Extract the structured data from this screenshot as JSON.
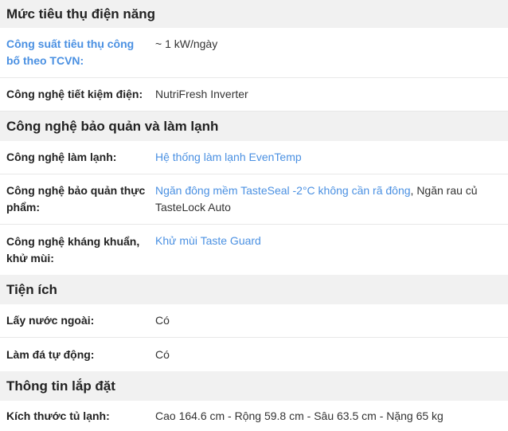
{
  "sections": [
    {
      "title": "Mức tiêu thụ điện năng",
      "rows": [
        {
          "label": "Công suất tiêu thụ công bố theo TCVN:",
          "value": "~ 1 kW/ngày"
        },
        {
          "label": "Công nghệ tiết kiệm điện:",
          "value": "NutriFresh Inverter"
        }
      ]
    },
    {
      "title": "Công nghệ bảo quản và làm lạnh",
      "rows": [
        {
          "label": "Công nghệ làm lạnh:",
          "value": "Hệ thống làm lạnh EvenTemp"
        },
        {
          "label": "Công nghệ bảo quản thực phẩm:",
          "value_link": "Ngăn đông mềm TasteSeal -2°C không cần rã đông",
          "value_rest": ", Ngăn rau củ TasteLock Auto"
        },
        {
          "label": "Công nghệ kháng khuẩn, khử mùi:",
          "value": "Khử mùi Taste Guard"
        }
      ]
    },
    {
      "title": "Tiện ích",
      "rows": [
        {
          "label": "Lấy nước ngoài:",
          "value": "Có"
        },
        {
          "label": "Làm đá tự động:",
          "value": "Có"
        }
      ]
    },
    {
      "title": "Thông tin lắp đặt",
      "rows": [
        {
          "label": "Kích thước tủ lạnh:",
          "value": "Cao 164.6 cm - Rộng 59.8 cm - Sâu 63.5 cm - Nặng 65 kg"
        }
      ]
    }
  ]
}
